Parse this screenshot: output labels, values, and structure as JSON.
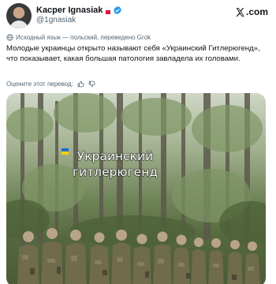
{
  "author": {
    "name": "Kacper Ignasiak",
    "handle": "@1gnasiak",
    "verified": true
  },
  "brand": {
    "label": ".com"
  },
  "translation_note": "Исходный язык — польский, переведено Grok",
  "tweet": {
    "text": "Молодые украинцы открыто называют себя «Украинский Гитлерюгенд», что показывает, какая большая патология завладела их головами."
  },
  "rate_translation": "Оцените этот перевод:",
  "media": {
    "caption_line1": "Украинский",
    "caption_line2": "гитлерюгенд"
  },
  "colors": {
    "accent": "#1d9bf0",
    "muted": "#536471",
    "text": "#0f1419"
  }
}
